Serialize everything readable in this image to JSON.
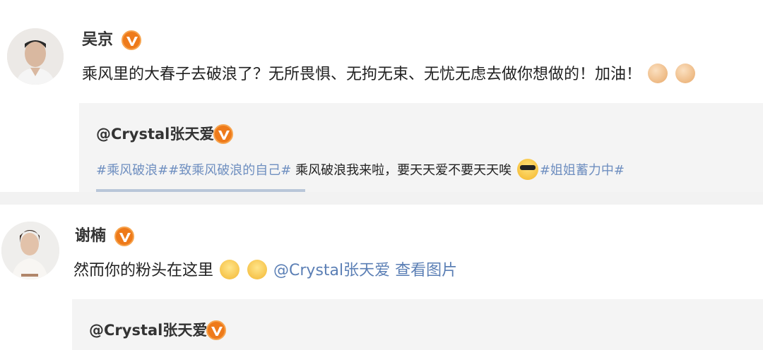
{
  "colors": {
    "accent_link": "#5b7fb5",
    "badge_orange": "#ee7a1a",
    "repost_bg": "#f4f4f4"
  },
  "posts": [
    {
      "username": "吴京",
      "content_text": "乘风里的大春子去破浪了？无所畏惧、无拘无束、无忧无虑去做你想做的！加油！",
      "content_emojis": [
        "strong-icon",
        "strong-icon"
      ],
      "repost": {
        "user": "@Crystal张天爱",
        "tag1": "#乘风破浪#",
        "tag2": "#致乘风破浪的自己#",
        "text": " 乘风破浪我来啦，要天天爱不要天天唉",
        "emoji": "sunglasses-icon",
        "tag3": "#姐姐蓄力中#"
      }
    },
    {
      "username": "谢楠",
      "content_text": "然而你的粉头在这里",
      "content_emojis": [
        "smile-icon",
        "smile-icon"
      ],
      "mention": "@Crystal张天爱",
      "view_image": "查看图片",
      "repost": {
        "user": "@Crystal张天爱"
      }
    }
  ]
}
